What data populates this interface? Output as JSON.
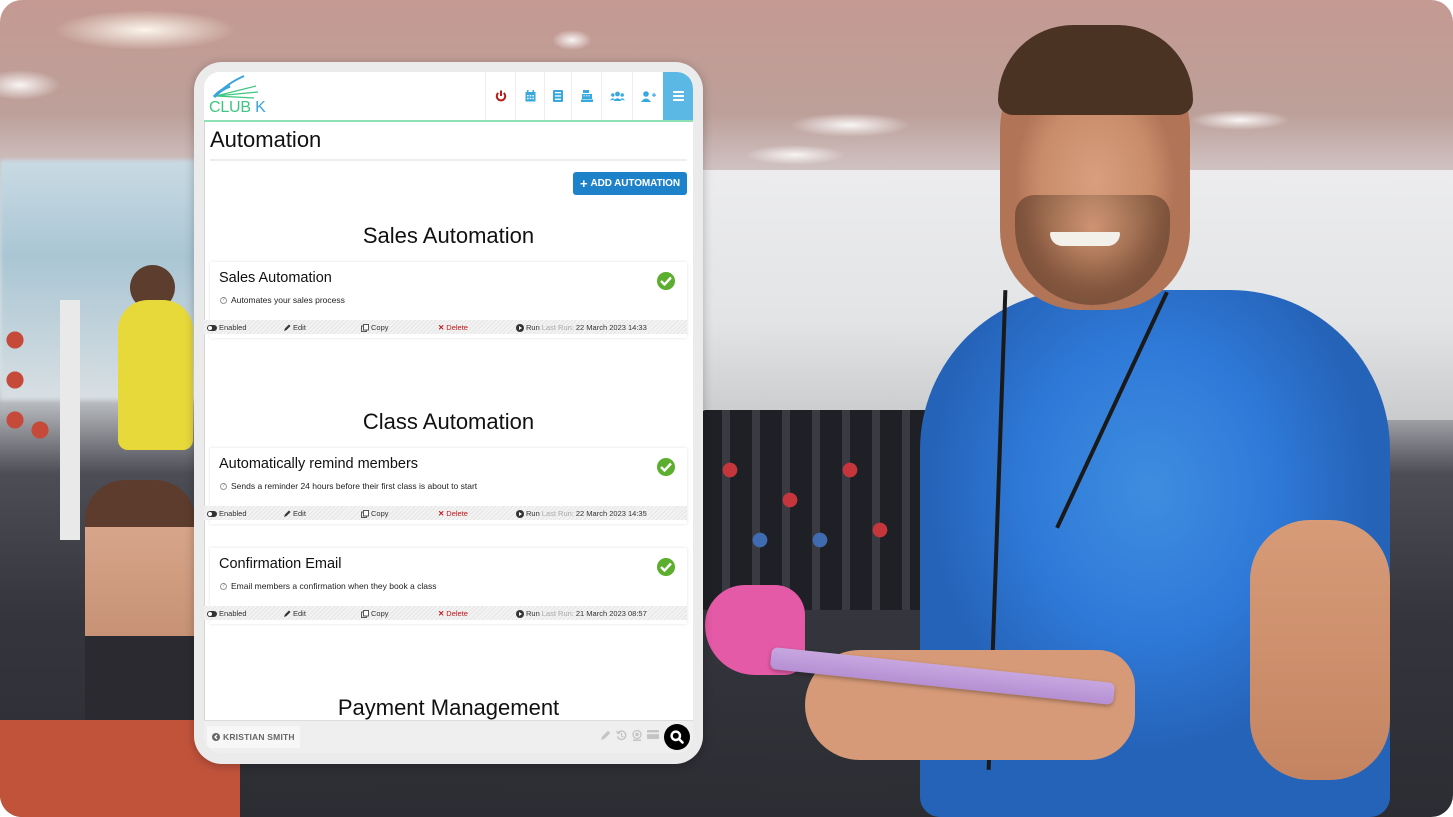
{
  "header": {
    "logo_text_part1": "CLUB",
    "logo_text_part2": "K",
    "nav_icons": [
      {
        "name": "power-icon",
        "color": "#b71c1c"
      },
      {
        "name": "calendar-icon",
        "color": "#38a9df"
      },
      {
        "name": "list-icon",
        "color": "#38a9df"
      },
      {
        "name": "cash-register-icon",
        "color": "#38a9df"
      },
      {
        "name": "users-icon",
        "color": "#38a9df"
      },
      {
        "name": "add-user-icon",
        "color": "#38a9df"
      },
      {
        "name": "menu-icon",
        "color": "#ffffff"
      }
    ]
  },
  "page": {
    "title": "Automation",
    "add_button_label": "ADD AUTOMATION"
  },
  "sections": [
    {
      "heading": "Sales Automation",
      "cards": [
        {
          "title": "Sales Automation",
          "description": "Automates your sales process",
          "status": "Enabled",
          "edit_label": "Edit",
          "copy_label": "Copy",
          "delete_label": "Delete",
          "run_label": "Run",
          "last_run_label": "Last Run:",
          "last_run": "22 March 2023 14:33"
        }
      ]
    },
    {
      "heading": "Class Automation",
      "cards": [
        {
          "title": "Automatically remind members",
          "description": "Sends a reminder 24 hours before their first class is about to start",
          "status": "Enabled",
          "edit_label": "Edit",
          "copy_label": "Copy",
          "delete_label": "Delete",
          "run_label": "Run",
          "last_run_label": "Last Run:",
          "last_run": "22 March 2023 14:35"
        },
        {
          "title": "Confirmation Email",
          "description": "Email members a confirmation when they book a class",
          "status": "Enabled",
          "edit_label": "Edit",
          "copy_label": "Copy",
          "delete_label": "Delete",
          "run_label": "Run",
          "last_run_label": "Last Run:",
          "last_run": "21 March 2023 08:57"
        }
      ]
    },
    {
      "heading": "Payment Management",
      "cards": []
    }
  ],
  "bottom_bar": {
    "user_name": "KRISTIAN SMITH",
    "tools": [
      "pencil-icon",
      "history-icon",
      "webcam-icon",
      "card-icon"
    ]
  },
  "colors": {
    "accent_blue": "#1e82cb",
    "menu_blue": "#5bb7e3",
    "success_green": "#5cae2e",
    "delete_red": "#c0161b",
    "logo_green": "#3ec781",
    "logo_blue": "#3aa4df"
  }
}
